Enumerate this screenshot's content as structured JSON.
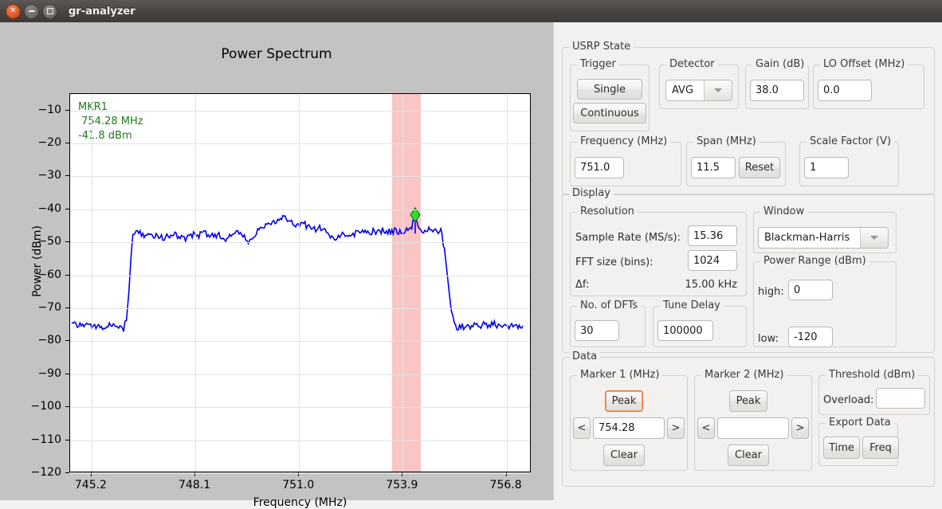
{
  "window": {
    "title": "gr-analyzer",
    "buttons": [
      {
        "name": "close",
        "glyph": "×"
      },
      {
        "name": "minimize",
        "glyph": "−"
      },
      {
        "name": "maximize",
        "glyph": "□"
      }
    ]
  },
  "plot": {
    "title": "Power Spectrum",
    "xlabel": "Frequency (MHz)",
    "ylabel": "Power (dBm)",
    "marker_annotation": {
      "name": "MKR1",
      "frequency": " 754.28 MHz",
      "power": "-41.8 dBm",
      "color": "#1e7a1e"
    },
    "trace_color": "#0000ee",
    "band_color": "#fac5c5"
  },
  "chart_data": {
    "type": "line",
    "title": "Power Spectrum",
    "xlabel": "Frequency (MHz)",
    "ylabel": "Power (dBm)",
    "xlim": [
      744.6,
      757.5
    ],
    "ylim": [
      -120,
      -5
    ],
    "xticks": [
      "745.2",
      "748.1",
      "751.0",
      "753.9",
      "756.8"
    ],
    "xtick_values": [
      745.2,
      748.1,
      751.0,
      753.9,
      756.8
    ],
    "yticks": [
      "−10",
      "−20",
      "−30",
      "−40",
      "−50",
      "−60",
      "−70",
      "−80",
      "−90",
      "−100",
      "−110",
      "−120"
    ],
    "ytick_values": [
      -10,
      -20,
      -30,
      -40,
      -50,
      -60,
      -70,
      -80,
      -90,
      -100,
      -110,
      -120
    ],
    "grid": true,
    "legend": "none",
    "highlight_band": {
      "x0": 753.6,
      "x1": 754.4,
      "color": "#fac5c5"
    },
    "marker": {
      "x": 754.28,
      "y": -41.8,
      "shape": "diamond",
      "color": "#2ee02e",
      "edge": "#0a6a0a"
    },
    "noise_floor_dbm": -75.5,
    "signal_plateau_dbm": -47.0,
    "signal_edges_mhz": [
      746.2,
      755.2
    ],
    "series": [
      {
        "name": "spectrum",
        "color": "#0000ee",
        "x": [
          744.65,
          744.8,
          744.95,
          745.1,
          745.25,
          745.4,
          745.55,
          745.7,
          745.85,
          746.0,
          746.1,
          746.18,
          746.25,
          746.3,
          746.36,
          746.45,
          746.6,
          746.75,
          746.9,
          747.05,
          747.2,
          747.35,
          747.5,
          747.65,
          747.8,
          747.95,
          748.1,
          748.25,
          748.4,
          748.55,
          748.7,
          748.85,
          749.0,
          749.15,
          749.3,
          749.45,
          749.6,
          749.75,
          749.9,
          750.05,
          750.2,
          750.35,
          750.5,
          750.6,
          750.7,
          750.85,
          751.0,
          751.15,
          751.3,
          751.45,
          751.6,
          751.75,
          751.9,
          752.05,
          752.2,
          752.35,
          752.5,
          752.65,
          752.8,
          752.95,
          753.1,
          753.25,
          753.4,
          753.55,
          753.7,
          753.85,
          754.0,
          754.15,
          754.28,
          754.4,
          754.55,
          754.7,
          754.85,
          755.0,
          755.1,
          755.2,
          755.3,
          755.45,
          755.6,
          755.75,
          755.9,
          756.05,
          756.2,
          756.35,
          756.5,
          756.65,
          756.8,
          756.95,
          757.1,
          757.3
        ],
        "y": [
          -75.6,
          -75.2,
          -76.0,
          -75.0,
          -75.8,
          -75.3,
          -76.1,
          -75.4,
          -75.9,
          -75.5,
          -76.4,
          -74.0,
          -65.0,
          -56.0,
          -47.2,
          -46.8,
          -47.4,
          -48.2,
          -47.6,
          -48.4,
          -49.0,
          -48.2,
          -47.8,
          -48.6,
          -49.2,
          -48.4,
          -47.6,
          -48.0,
          -47.4,
          -48.2,
          -47.8,
          -48.6,
          -49.4,
          -48.0,
          -47.2,
          -48.4,
          -49.6,
          -47.8,
          -46.4,
          -45.2,
          -44.4,
          -43.6,
          -43.0,
          -42.8,
          -43.4,
          -44.2,
          -45.0,
          -44.4,
          -45.6,
          -46.2,
          -45.4,
          -46.8,
          -48.2,
          -49.4,
          -48.2,
          -47.4,
          -48.0,
          -47.2,
          -46.8,
          -47.4,
          -46.6,
          -47.2,
          -46.4,
          -47.0,
          -46.6,
          -47.2,
          -46.8,
          -46.2,
          -41.8,
          -46.4,
          -46.8,
          -46.4,
          -46.8,
          -47.0,
          -52.0,
          -62.0,
          -72.0,
          -76.4,
          -75.6,
          -76.2,
          -75.4,
          -76.0,
          -75.2,
          -75.8,
          -75.0,
          -75.6,
          -75.2,
          -75.8,
          -75.4,
          -75.6
        ]
      }
    ]
  },
  "usrp_state": {
    "legend": "USRP State",
    "trigger": {
      "legend": "Trigger",
      "single": "Single",
      "continuous": "Continuous"
    },
    "detector": {
      "legend": "Detector",
      "value": "AVG"
    },
    "gain": {
      "legend": "Gain (dB)",
      "value": "38.0"
    },
    "lo_offset": {
      "legend": "LO Offset (MHz)",
      "value": "0.0"
    },
    "frequency": {
      "legend": "Frequency (MHz)",
      "value": "751.0"
    },
    "span": {
      "legend": "Span (MHz)",
      "value": "11.5",
      "reset": "Reset"
    },
    "scale_factor": {
      "legend": "Scale Factor (V)",
      "value": "1"
    }
  },
  "display": {
    "legend": "Display",
    "resolution": {
      "legend": "Resolution",
      "sample_rate_label": "Sample Rate (MS/s):",
      "sample_rate_value": "15.36",
      "fft_size_label": "FFT size (bins):",
      "fft_size_value": "1024",
      "delta_f_label": "Δf:",
      "delta_f_value": "15.00 kHz"
    },
    "dfts": {
      "legend": "No. of DFTs",
      "value": "30"
    },
    "tune_delay": {
      "legend": "Tune Delay",
      "value": "100000"
    },
    "window": {
      "legend": "Window",
      "value": "Blackman-Harris"
    },
    "power_range": {
      "legend": "Power Range (dBm)",
      "high_label": "high:",
      "high_value": "0",
      "low_label": "low:",
      "low_value": "-120"
    }
  },
  "data": {
    "legend": "Data",
    "marker1": {
      "legend": "Marker 1 (MHz)",
      "peak": "Peak",
      "prev": "<",
      "next": ">",
      "value": "754.28",
      "clear": "Clear",
      "focused": true
    },
    "marker2": {
      "legend": "Marker 2 (MHz)",
      "peak": "Peak",
      "prev": "<",
      "next": ">",
      "value": "",
      "clear": "Clear"
    },
    "threshold": {
      "legend": "Threshold (dBm)",
      "overload_label": "Overload:",
      "overload_value": ""
    },
    "export": {
      "legend": "Export Data",
      "time": "Time",
      "freq": "Freq"
    }
  }
}
